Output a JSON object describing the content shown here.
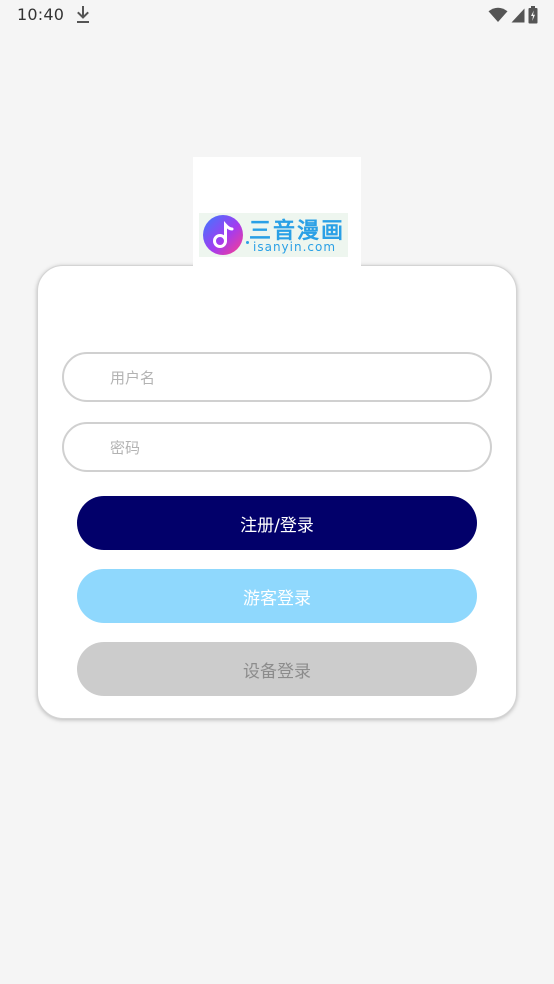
{
  "status_bar": {
    "time": "10:40",
    "icons": [
      "download-icon",
      "wifi-icon",
      "signal-icon",
      "battery-icon"
    ]
  },
  "logo": {
    "title": "三音漫画",
    "subtitle": "isanyin.com",
    "colors": {
      "text": "#2aa0e6",
      "circle_start": "#3a7bff",
      "circle_end": "#ff3d8a"
    }
  },
  "form": {
    "username": {
      "value": "",
      "placeholder": "用户名"
    },
    "password": {
      "value": "",
      "placeholder": "密码"
    }
  },
  "buttons": {
    "register_login": "注册/登录",
    "guest_login": "游客登录",
    "device_login": "设备登录"
  },
  "colors": {
    "background": "#f5f5f5",
    "primary": "#02006a",
    "guest": "#8fd8fd",
    "device": "#cccccc",
    "device_text": "#8c8c8c"
  }
}
